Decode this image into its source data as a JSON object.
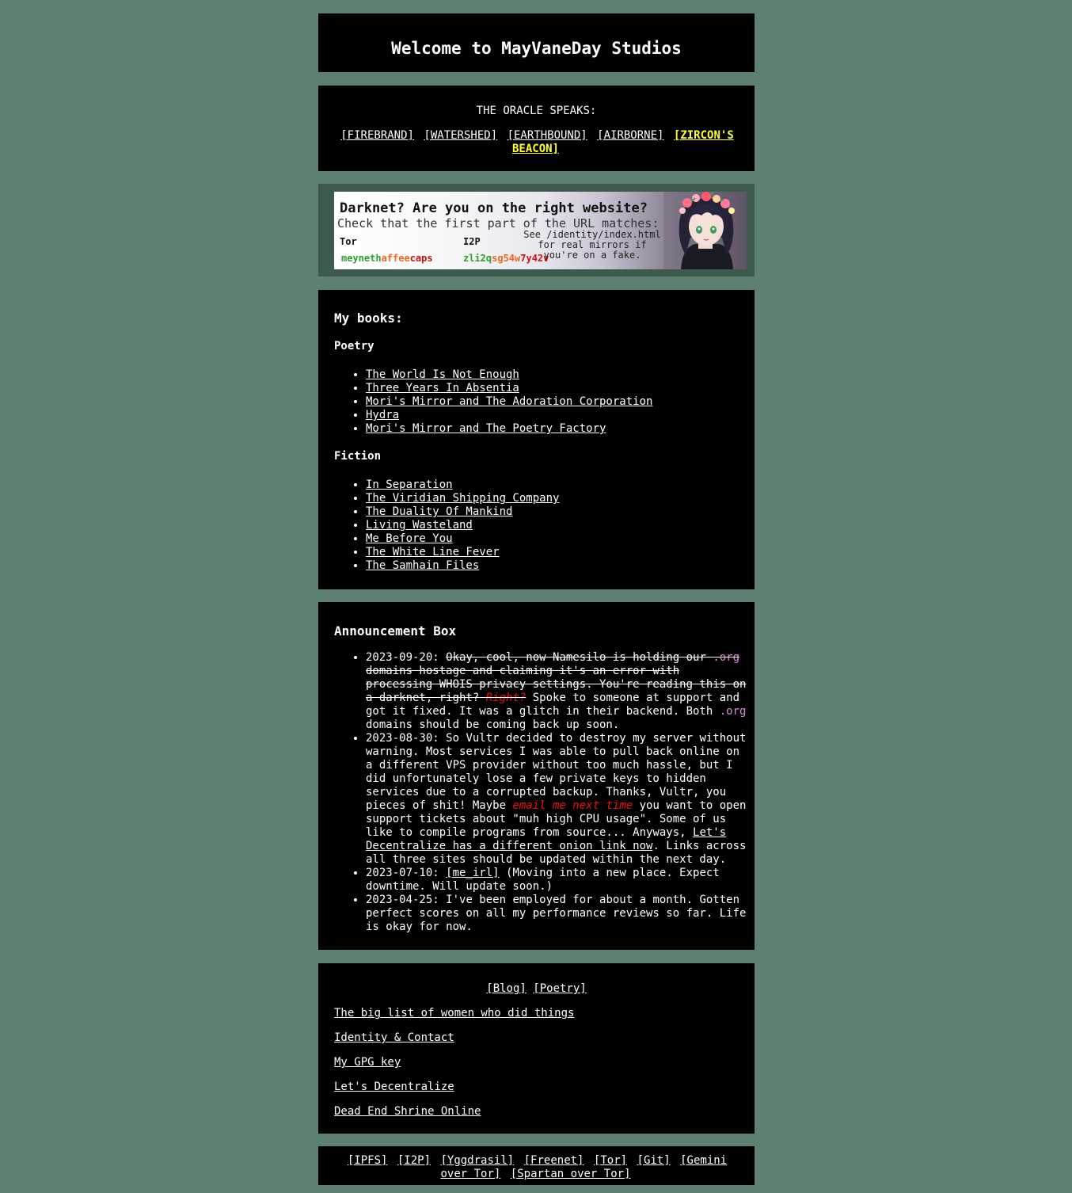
{
  "header": {
    "title": "Welcome to MayVaneDay Studios"
  },
  "oracle": {
    "heading": "THE ORACLE SPEAKS:",
    "links": [
      "[FIREBRAND]",
      "[WATERSHED]",
      "[EARTHBOUND]",
      "[AIRBORNE]"
    ],
    "beacon": "[ZIRCON'S BEACON]",
    "beacon_color": "#ffff33"
  },
  "banner": {
    "question": "Darknet? Are you on the right website?",
    "check": "Check that the first part of the URL matches:",
    "tor_label": "Tor",
    "i2p_label": "I2P",
    "tor_url": [
      "meyneth",
      "affee",
      "caps"
    ],
    "i2p_url": [
      "zli2q",
      "sg54w",
      "7y42v"
    ],
    "see_note": [
      "See /identity/index.html",
      "for real mirrors if",
      "you're on a fake."
    ]
  },
  "books": {
    "heading": "My books:",
    "poetry_heading": "Poetry",
    "poetry": [
      "The World Is Not Enough",
      "Three Years In Absentia",
      "Mori's Mirror and The Adoration Corporation",
      "Hydra",
      "Mori's Mirror and The Poetry Factory"
    ],
    "fiction_heading": "Fiction",
    "fiction": [
      "In Separation",
      "The Viridian Shipping Company",
      "The Duality Of Mankind",
      "Living Wasteland",
      "Me Before You",
      "The White Line Fever",
      "The Samhain Files"
    ]
  },
  "announcements": {
    "heading": "Announcement Box",
    "a1": {
      "date": "2023-09-20:",
      "struck1": "Okay, cool, now Namesilo is holding our",
      "org": ".org",
      "struck2": "domains hostage and claiming it's an error with processing WHOIS privacy settings. You're reading this on a darknet, right?",
      "right": "Right?",
      "text1": "Spoke to someone at support and got it fixed. It was a glitch in their backend. Both",
      "text2": "domains should be coming back up soon."
    },
    "a2": {
      "date": "2023-08-30:",
      "text1": "So Vultr decided to destroy my server without warning. Most services I was able to pull back online on a different VPS provider without too much hassle, but I did unfortunately lose a few private keys to hidden services due to a corrupted backup. Thanks, Vultr, you pieces of shit! Maybe",
      "email": "email me next time",
      "text2": "you want to open support tickets about \"muh high CPU usage\". Some of us like to compile programs from source... Anyways,",
      "link": "Let's Decentralize has a different onion link now",
      "text3": ". Links across all three sites should be updated within the next day."
    },
    "a3": {
      "date": "2023-07-10:",
      "link": "[me_irl]",
      "text": "(Moving into a new place. Expect downtime. Will update soon.)"
    },
    "a4": {
      "date": "2023-04-25:",
      "text": "I've been employed for about a month. Gotten perfect scores on all my performance reviews so far. Life is okay for now."
    }
  },
  "links": {
    "blog": "[Blog]",
    "poetry": "[Poetry]",
    "items": [
      "The big list of women who did things",
      "Identity & Contact",
      "My GPG key",
      "Let's Decentralize",
      "Dead End Shrine Online"
    ]
  },
  "footer": {
    "nets": [
      "[IPFS]",
      "[I2P]",
      "[Yggdrasil]",
      "[Freenet]",
      "[Tor]",
      "[Git]",
      "[Gemini over Tor]",
      "[Spartan over Tor]"
    ]
  },
  "colors": {
    "background": "#5e8070",
    "panel": "#000000",
    "beacon": "#ffff33",
    "org": "#dd88dd",
    "alert": "#ee1111"
  }
}
